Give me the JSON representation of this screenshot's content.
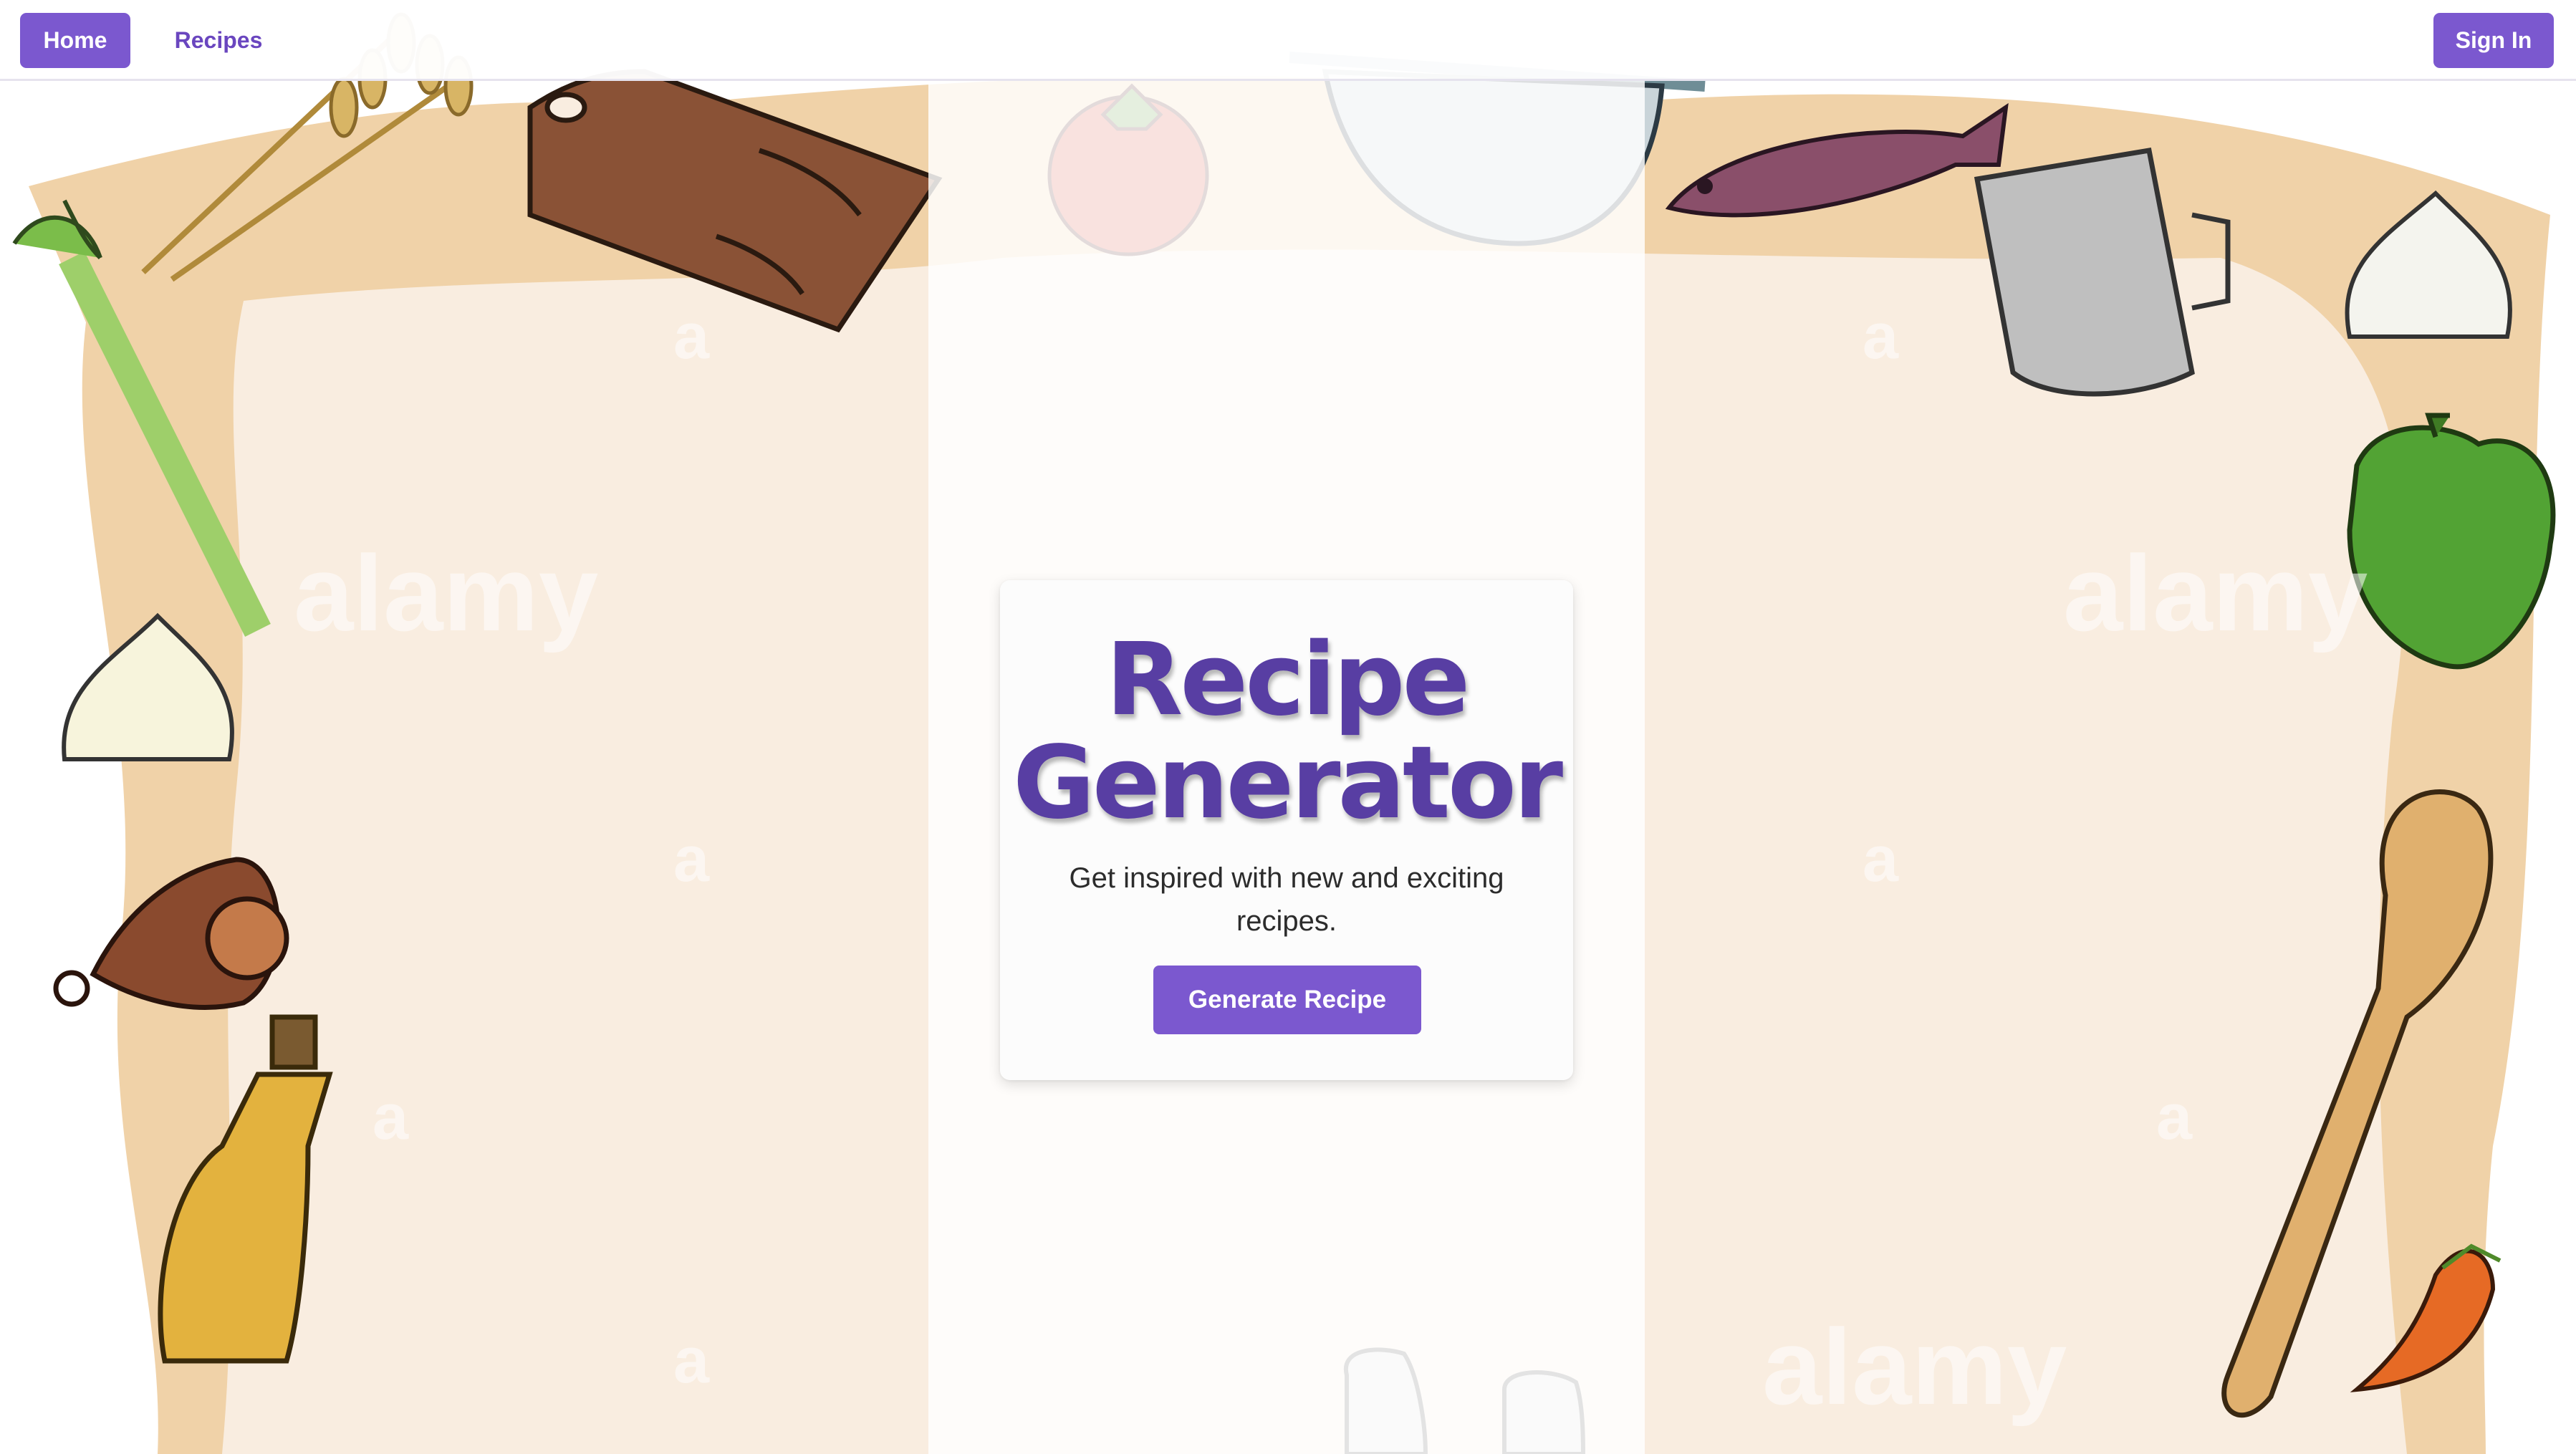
{
  "nav": {
    "home_label": "Home",
    "recipes_label": "Recipes",
    "signin_label": "Sign In"
  },
  "hero": {
    "title_line1": "Recipe",
    "title_line2": "Generator",
    "subtitle": "Get inspired with new and exciting recipes.",
    "button_label": "Generate Recipe"
  },
  "background": {
    "watermark_text": "alamy",
    "watermark_mark": "a",
    "illustrations": [
      "wheat-icon",
      "cutting-board-icon",
      "tomato-icon",
      "colander-icon",
      "fish-icon",
      "measuring-cup-icon",
      "garlic-icon",
      "leek-icon",
      "bell-pepper-icon",
      "ham-icon",
      "oil-bottle-icon",
      "wooden-spoon-icon",
      "chili-pepper-icon",
      "salt-shaker-icon"
    ]
  },
  "colors": {
    "accent": "#7b58cf",
    "title": "#583ea3",
    "paper": "#f9ede0",
    "paper_border": "#edcfa6"
  }
}
